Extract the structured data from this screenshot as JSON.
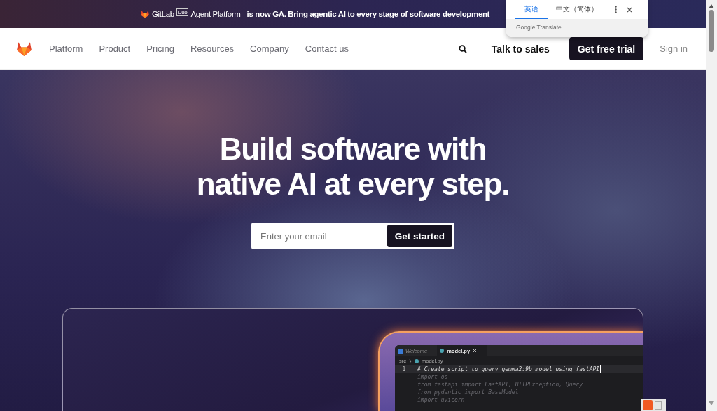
{
  "banner": {
    "brand": "GitLab",
    "badge": "Duo",
    "product": "Agent Platform",
    "message": "is now GA. Bring agentic AI to every stage of software development"
  },
  "nav": {
    "items": [
      {
        "label": "Platform"
      },
      {
        "label": "Product"
      },
      {
        "label": "Pricing"
      },
      {
        "label": "Resources"
      },
      {
        "label": "Company"
      },
      {
        "label": "Contact us"
      }
    ],
    "actions": [
      {
        "kind": "search"
      },
      {
        "kind": "link",
        "label": "Talk to sales"
      },
      {
        "kind": "primary",
        "label": "Get free trial"
      },
      {
        "kind": "muted",
        "label": "Sign in"
      }
    ]
  },
  "hero": {
    "title_lines": [
      "Build software with",
      "native AI at every step."
    ],
    "email": {
      "placeholder": "Enter your email"
    },
    "button": "Get started"
  },
  "editor": {
    "tabs": [
      {
        "label": "Welcome",
        "selected": false
      },
      {
        "label": "model.py",
        "selected": true
      }
    ],
    "breadcrumb": [
      "src",
      "model.py"
    ],
    "lines": [
      {
        "kind": "typed",
        "number": "1",
        "text": "# Create script to query gemma2:9b model using fastAPI"
      },
      {
        "kind": "suggestion",
        "text": "import os"
      },
      {
        "kind": "suggestion",
        "text": "from fastapi import FastAPI, HTTPException, Query"
      },
      {
        "kind": "suggestion",
        "text": "from pydantic import BaseModel"
      },
      {
        "kind": "suggestion",
        "text": "import uvicorn"
      }
    ]
  },
  "translate_popup": {
    "tabs": [
      {
        "label": "英语",
        "selected": true
      },
      {
        "label": "中文（简体）",
        "selected": false
      }
    ],
    "footer": "Google Translate"
  }
}
